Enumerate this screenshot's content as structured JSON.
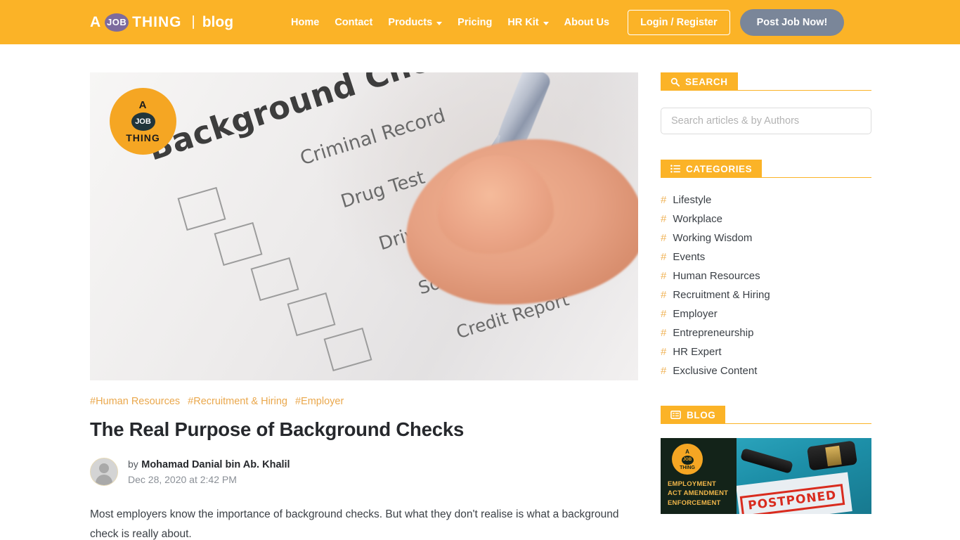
{
  "header": {
    "brand": {
      "a": "A",
      "job": "JOB",
      "thing": "THING",
      "separator": "|",
      "blog": "blog"
    },
    "nav": [
      {
        "label": "Home",
        "has_dropdown": false
      },
      {
        "label": "Contact",
        "has_dropdown": false
      },
      {
        "label": "Products",
        "has_dropdown": true
      },
      {
        "label": "Pricing",
        "has_dropdown": false
      },
      {
        "label": "HR Kit",
        "has_dropdown": true
      },
      {
        "label": "About Us",
        "has_dropdown": false
      }
    ],
    "login_label": "Login / Register",
    "post_job_label": "Post Job Now!",
    "bg_color": "#fbb327",
    "post_job_color": "#7a8699"
  },
  "hero": {
    "title": "Background Check",
    "items": [
      "Criminal Record",
      "Drug Test",
      "Driving Record",
      "Social Security",
      "Credit Report"
    ],
    "watermark": {
      "a": "A",
      "job": "JOB",
      "thing": "THING"
    }
  },
  "article": {
    "tags": [
      "#Human Resources",
      "#Recruitment & Hiring",
      "#Employer"
    ],
    "title": "The Real Purpose of Background Checks",
    "by_label": "by",
    "author": "Mohamad Danial bin Ab. Khalil",
    "date": "Dec 28, 2020 at 2:42 PM",
    "body": "Most employers know the importance of background checks. But what they don't realise is what a background check is really about."
  },
  "sidebar": {
    "search": {
      "heading": "SEARCH",
      "icon": "search-icon",
      "placeholder": "Search articles & by Authors",
      "value": ""
    },
    "categories": {
      "heading": "CATEGORIES",
      "icon": "list-icon",
      "items": [
        "Lifestyle",
        "Workplace",
        "Working Wisdom",
        "Events",
        "Human Resources",
        "Recruitment & Hiring",
        "Employer",
        "Entrepreneurship",
        "HR Expert",
        "Exclusive Content"
      ],
      "hash": "#"
    },
    "blog": {
      "heading": "BLOG",
      "icon": "list-alt-icon",
      "thumbnail": {
        "logo": {
          "a": "A",
          "job": "JOB",
          "thing": "THING"
        },
        "caption": "EMPLOYMENT\nACT AMENDMENT\nENFORCEMENT",
        "stamp": "POSTPONED"
      }
    }
  },
  "colors": {
    "accent": "#fbb327",
    "tag": "#eaa84d",
    "text": "#3b4046",
    "title": "#26282c",
    "muted": "#8a8f96"
  }
}
